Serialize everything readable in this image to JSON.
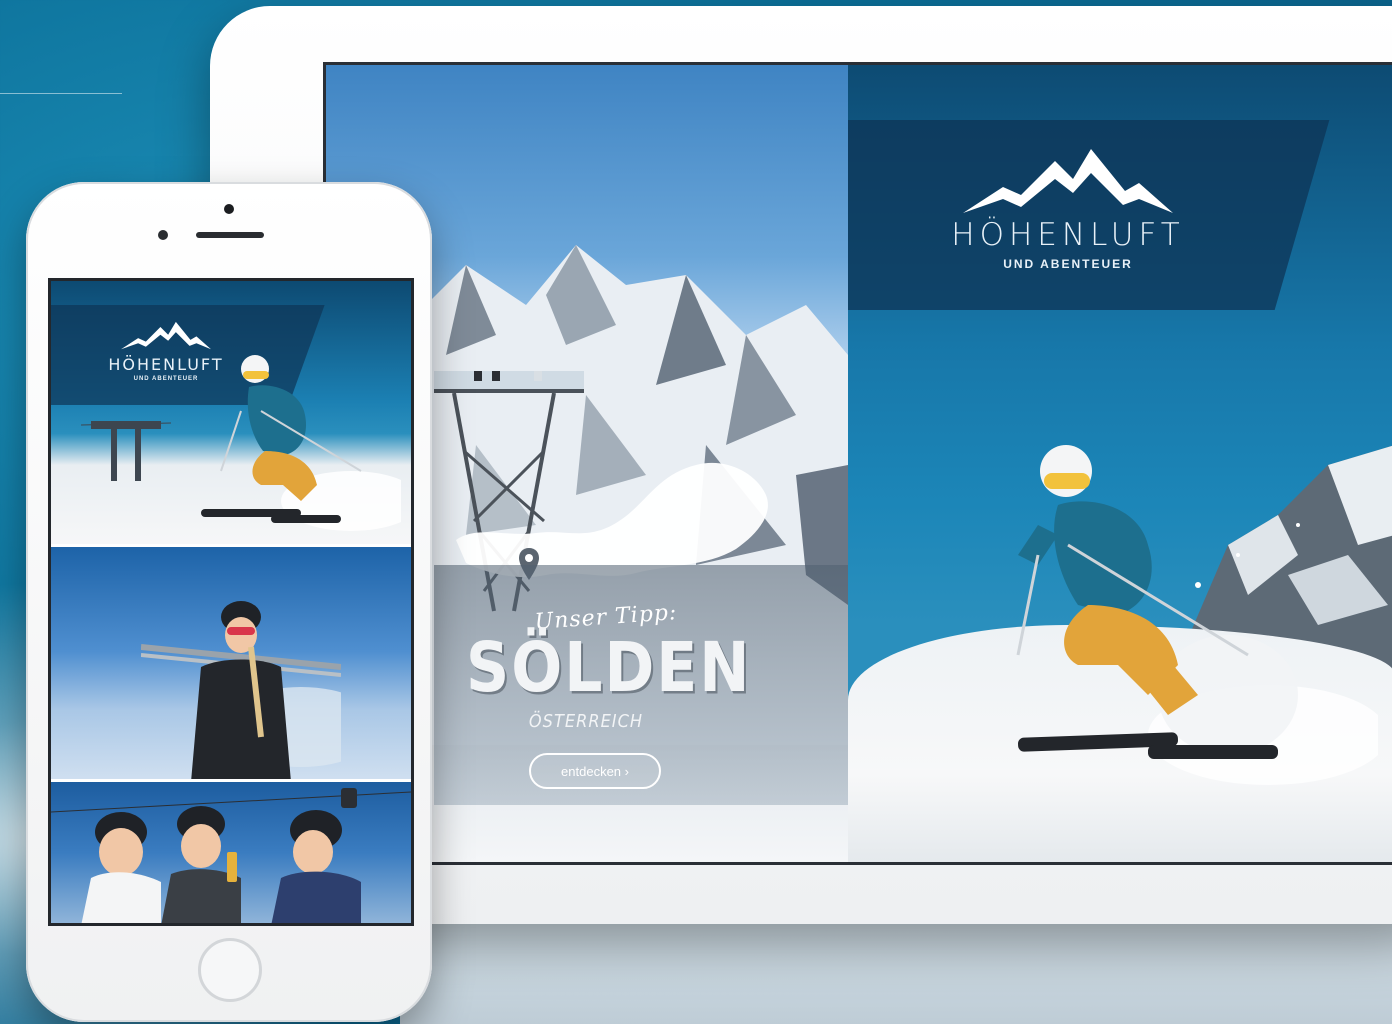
{
  "tablet": {
    "brand": {
      "title": "HÖHENLUFT",
      "subtitle": "UND ABENTEUER"
    },
    "tip": {
      "kicker": "Unser Tipp:",
      "destination": "SÖLDEN",
      "country": "ÖSTERREICH",
      "button_label": "entdecken ›"
    }
  },
  "phone": {
    "brand": {
      "title": "HÖHENLUFT",
      "subtitle": "UND ABENTEUER"
    }
  },
  "colors": {
    "background": "#0b6f98",
    "header_band": "#0e3455",
    "brand_text": "#e8f1f8",
    "sky": "#1c86b8",
    "snow": "#f4f6f8",
    "jacket": "#1d6f8e",
    "pants": "#e2a43a"
  },
  "icons": [
    "mountain-logo-icon",
    "map-pin-icon",
    "chevron-right-icon"
  ]
}
